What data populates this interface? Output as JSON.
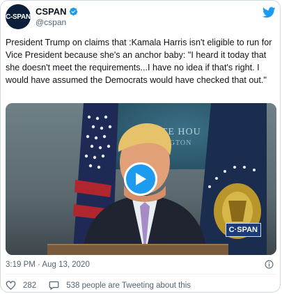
{
  "author": {
    "avatar_text": "C-SPAN",
    "display_name": "CSPAN",
    "handle": "@cspan",
    "verified_icon": "verified-badge-icon"
  },
  "brand_icon": "twitter-bird-icon",
  "tweet": {
    "text": "President Trump on claims that :Kamala Harris isn't eligible to run for Vice President because she's an anchor baby: \"I heard it today that she doesn't meet the requirements...I have no idea if that's right. I would have assumed the Democrats would have checked that out.\""
  },
  "media": {
    "kind": "video",
    "building_text": "HITE HOU",
    "building_subtext": "HINGTON",
    "network_bug": "C·SPAN",
    "play_icon": "play-icon"
  },
  "meta": {
    "timestamp": "3:19 PM · Aug 13, 2020",
    "info_icon": "info-icon"
  },
  "actions": {
    "like_count": "282",
    "conversation_label": "538 people are Tweeting about this"
  },
  "colors": {
    "accent": "#1d9bf0",
    "text": "#0f1419",
    "muted": "#536471",
    "border": "#cfd9de"
  }
}
